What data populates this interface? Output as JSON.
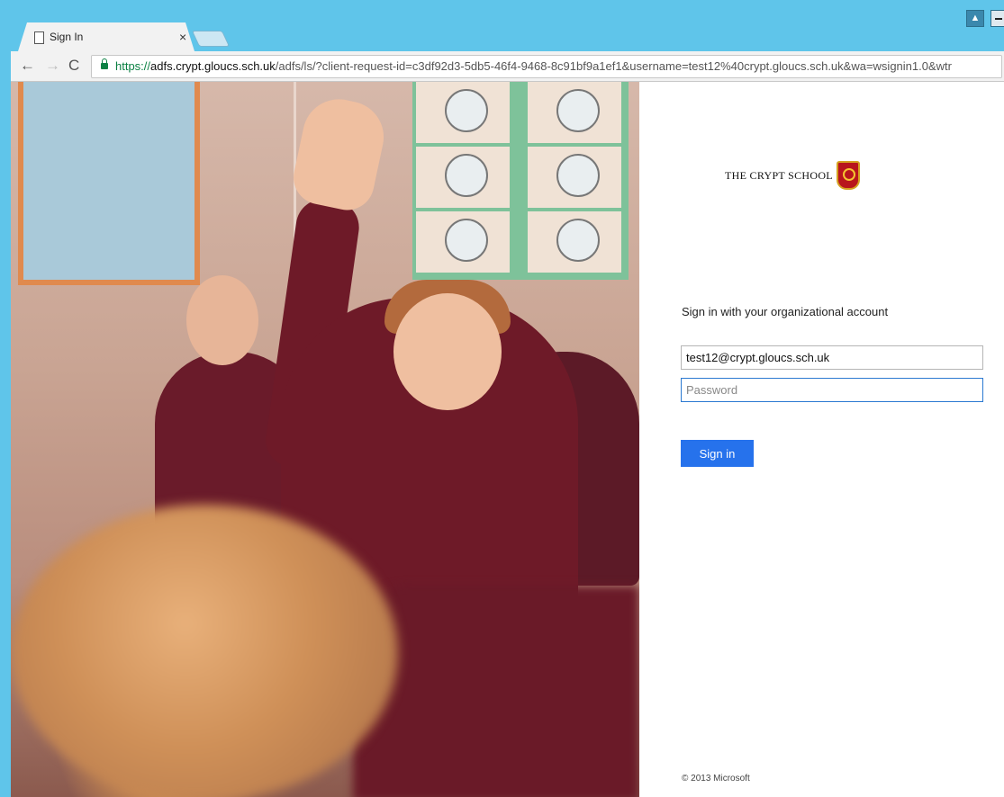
{
  "window": {
    "user_icon": "person-icon"
  },
  "tab": {
    "title": "Sign In",
    "close_label": "×"
  },
  "toolbar": {
    "back_label": "←",
    "forward_label": "→",
    "reload_label": "C",
    "url_scheme": "https://",
    "url_host": "adfs.crypt.gloucs.sch.uk",
    "url_path": "/adfs/ls/?client-request-id=c3df92d3-5db5-46f4-9468-8c91bf9a1ef1&username=test12%40crypt.gloucs.sch.uk&wa=wsignin1.0&wtr"
  },
  "login": {
    "school_name": "THE CRYPT SCHOOL",
    "heading": "Sign in with your organizational account",
    "username_value": "test12@crypt.gloucs.sch.uk",
    "password_placeholder": "Password",
    "signin_label": "Sign in",
    "footer": "© 2013 Microsoft"
  },
  "colors": {
    "accent": "#2672ec",
    "title_bar": "#5fc5ea",
    "secure_green": "#0b8043"
  }
}
